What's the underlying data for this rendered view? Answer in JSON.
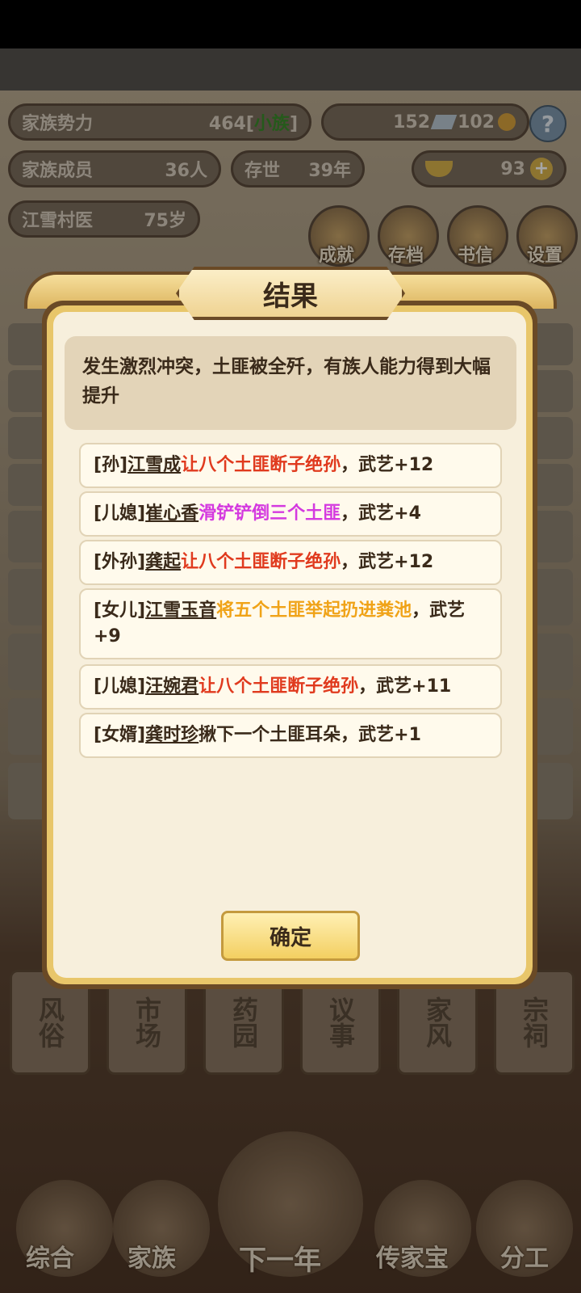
{
  "stats": {
    "family_power_label": "家族势力",
    "family_power_value": "464",
    "family_power_rank": "小族",
    "silver": "152",
    "copper": "102",
    "members_label": "家族成员",
    "members_value": "36人",
    "alive_label": "存世",
    "alive_value": "39年",
    "gold": "93",
    "person_label": "江雪村医",
    "person_age": "75岁"
  },
  "top_buttons": [
    {
      "label": "成就",
      "icon": "achievement-icon"
    },
    {
      "label": "存档",
      "icon": "save-icon"
    },
    {
      "label": "书信",
      "icon": "letter-icon"
    },
    {
      "label": "设置",
      "icon": "settings-icon"
    }
  ],
  "nav_buttons": [
    "风俗",
    "市场",
    "药园",
    "议事",
    "家风",
    "宗祠"
  ],
  "bottom_buttons": [
    "综合",
    "家族",
    "下一年",
    "传家宝",
    "分工"
  ],
  "dialog": {
    "title": "结果",
    "description": "发生激烈冲突，土匪被全歼，有族人能力得到大幅提升",
    "results": [
      {
        "relation": "[孙]",
        "name": "江雪成",
        "action": "让八个土匪断子绝孙",
        "action_color": "#e03a1e",
        "suffix": "，武艺+12"
      },
      {
        "relation": "[儿媳]",
        "name": "崔心香",
        "action": "滑铲铲倒三个土匪",
        "action_color": "#d43adf",
        "suffix": "，武艺+4"
      },
      {
        "relation": "[外孙]",
        "name": "龚起",
        "action": "让八个土匪断子绝孙",
        "action_color": "#e03a1e",
        "suffix": "，武艺+12"
      },
      {
        "relation": "[女儿]",
        "name": "江雪玉音",
        "action": "将五个土匪举起扔进粪池",
        "action_color": "#f0a318",
        "suffix": "，武艺+9"
      },
      {
        "relation": "[儿媳]",
        "name": "汪婉君",
        "action": "让八个土匪断子绝孙",
        "action_color": "#e03a1e",
        "suffix": "，武艺+11"
      },
      {
        "relation": "[女婿]",
        "name": "龚时珍",
        "action": "揪下一个土匪耳朵",
        "action_color": "#3a2a1a",
        "suffix": "，武艺+1"
      }
    ],
    "confirm_label": "确定"
  }
}
